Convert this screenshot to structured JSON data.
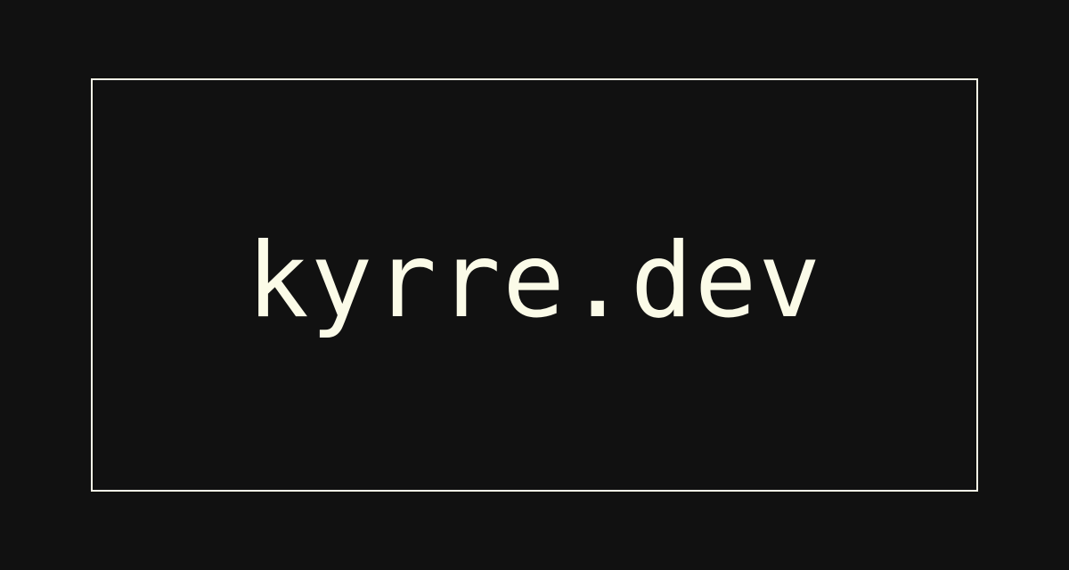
{
  "site": {
    "title": "kyrre.dev"
  },
  "colors": {
    "background": "#111111",
    "foreground": "#fbfbe8"
  }
}
